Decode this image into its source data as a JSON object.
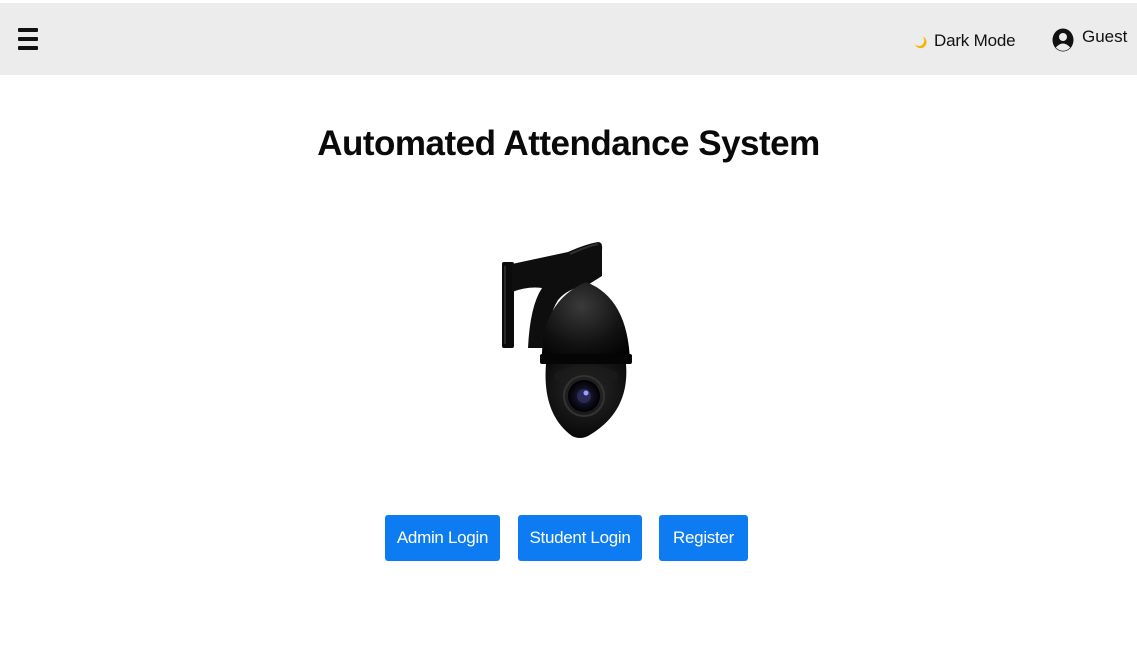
{
  "header": {
    "menu_icon": "hamburger-menu-icon",
    "dark_mode_icon": "moon-icon",
    "dark_mode_label": "Dark Mode",
    "user_icon": "user-circle-icon",
    "user_label": "Guest"
  },
  "main": {
    "title": "Automated Attendance System",
    "image": "security-camera-image"
  },
  "actions": {
    "admin_login_label": "Admin Login",
    "student_login_label": "Student Login",
    "register_label": "Register"
  },
  "colors": {
    "header_background": "#ececec",
    "button_primary": "#0d7cf2",
    "button_text": "#ffffff",
    "moon_icon": "#f2b705"
  }
}
